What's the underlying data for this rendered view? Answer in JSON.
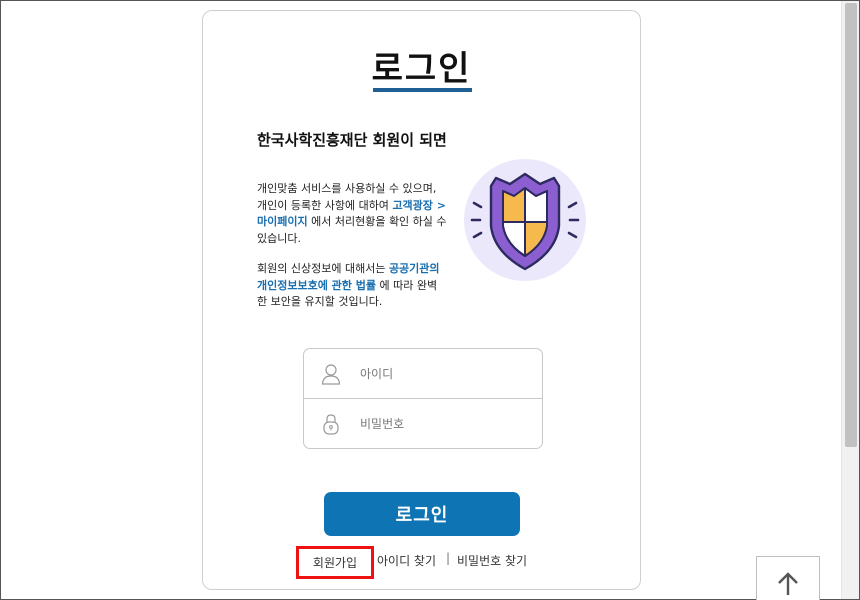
{
  "page": {
    "title": "로그인"
  },
  "intro": {
    "heading": "한국사학진흥재단 회원이 되면",
    "para1_before": "개인맞춤 서비스를 사용하실 수 있으며, 개인이 등록한 사항에 대하여 ",
    "para1_link": "고객광장 > 마이페이지",
    "para1_after": " 에서 처리현황을 확인 하실 수 있습니다.",
    "para2_before": "회원의 신상정보에 대해서는 ",
    "para2_link": "공공기관의 개인정보보호에 관한 법률",
    "para2_after": " 에 따라 완벽한 보안을 유지할 것입니다."
  },
  "form": {
    "id_placeholder": "아이디",
    "password_placeholder": "비밀번호",
    "login_button": "로그인"
  },
  "links": {
    "signup": "회원가입",
    "find_id": "아이디 찾기",
    "separator": "|",
    "find_password": "비밀번호 찾기"
  },
  "icons": {
    "shield": "shield-icon",
    "user": "user-icon",
    "lock": "lock-icon",
    "top": "arrow-up-icon"
  },
  "colors": {
    "accent_blue": "#0f74b3",
    "title_underline": "#1f5f94",
    "link_blue": "#1a6fb0",
    "highlight_red": "#ee1111",
    "shield_purple": "#8b5fd0",
    "shield_gold": "#f6b94e"
  }
}
